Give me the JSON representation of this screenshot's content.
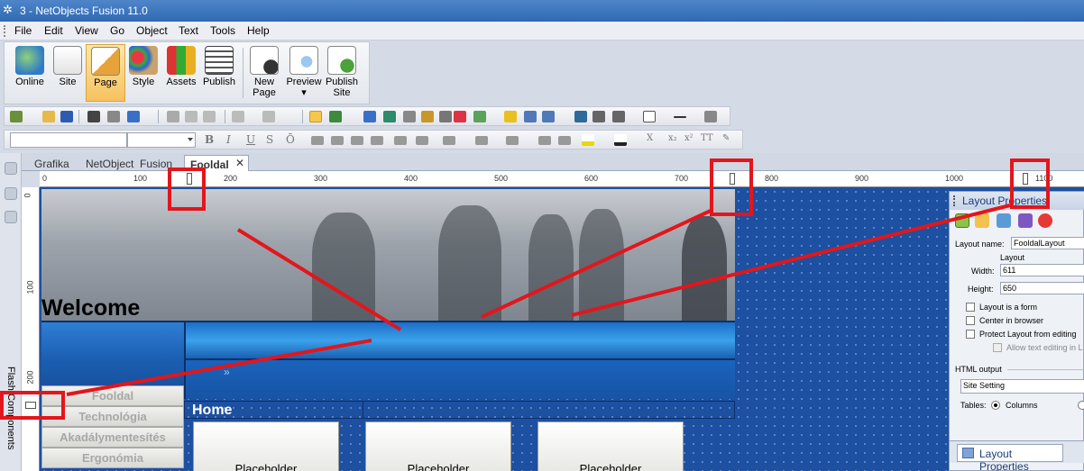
{
  "window": {
    "title": "3 - NetObjects Fusion 11.0"
  },
  "menu": [
    "File",
    "Edit",
    "View",
    "Go",
    "Object",
    "Text",
    "Tools",
    "Help"
  ],
  "views": [
    {
      "label": "Online",
      "icon": "globe-icon"
    },
    {
      "label": "Site",
      "icon": "site-structure-icon"
    },
    {
      "label": "Page",
      "icon": "page-pencil-icon",
      "active": true
    },
    {
      "label": "Style",
      "icon": "palette-icon"
    },
    {
      "label": "Assets",
      "icon": "assets-cubes-icon"
    },
    {
      "label": "Publish",
      "icon": "publish-stack-icon"
    },
    {
      "label": "New\nPage",
      "icon": "new-page-icon"
    },
    {
      "label": "Preview\n▾",
      "icon": "preview-magnifier-icon"
    },
    {
      "label": "Publish\nSite",
      "icon": "publish-site-icon"
    }
  ],
  "tabs": [
    {
      "label": "Grafika"
    },
    {
      "label": "NetObject  Fusion"
    },
    {
      "label": "Fooldal",
      "active": true
    }
  ],
  "left_panel": {
    "label": "Flash Components"
  },
  "ruler": {
    "h": [
      "0",
      "100",
      "200",
      "300",
      "400",
      "500",
      "600",
      "700",
      "800",
      "900",
      "1000",
      "1100"
    ],
    "v": [
      "0",
      "100",
      "200"
    ]
  },
  "page": {
    "welcome": "Welcome",
    "nav": [
      "Fooldal",
      "Technológia",
      "Akadálymentesítés",
      "Ergonómia"
    ],
    "home_label": "Home",
    "placeholders": [
      "Placeholder",
      "Placeholder",
      "Placeholder"
    ]
  },
  "properties": {
    "title": "Layout Properties",
    "layout_name_label": "Layout name:",
    "layout_name_value": "FooldalLayout",
    "layout_group": "Layout",
    "width_label": "Width:",
    "width_value": "611",
    "height_label": "Height:",
    "height_value": "650",
    "options": [
      "Layout is a form",
      "Center in browser",
      "Protect Layout from editing",
      "Allow text editing in L"
    ],
    "html_output_label": "HTML output",
    "html_output_value": "Site Setting",
    "tables_label": "Tables:",
    "tables_value": "Columns",
    "footer_tab": "Layout Properties"
  },
  "colors": {
    "annotation": "#e2161c",
    "canvas": "#1d50a0"
  }
}
